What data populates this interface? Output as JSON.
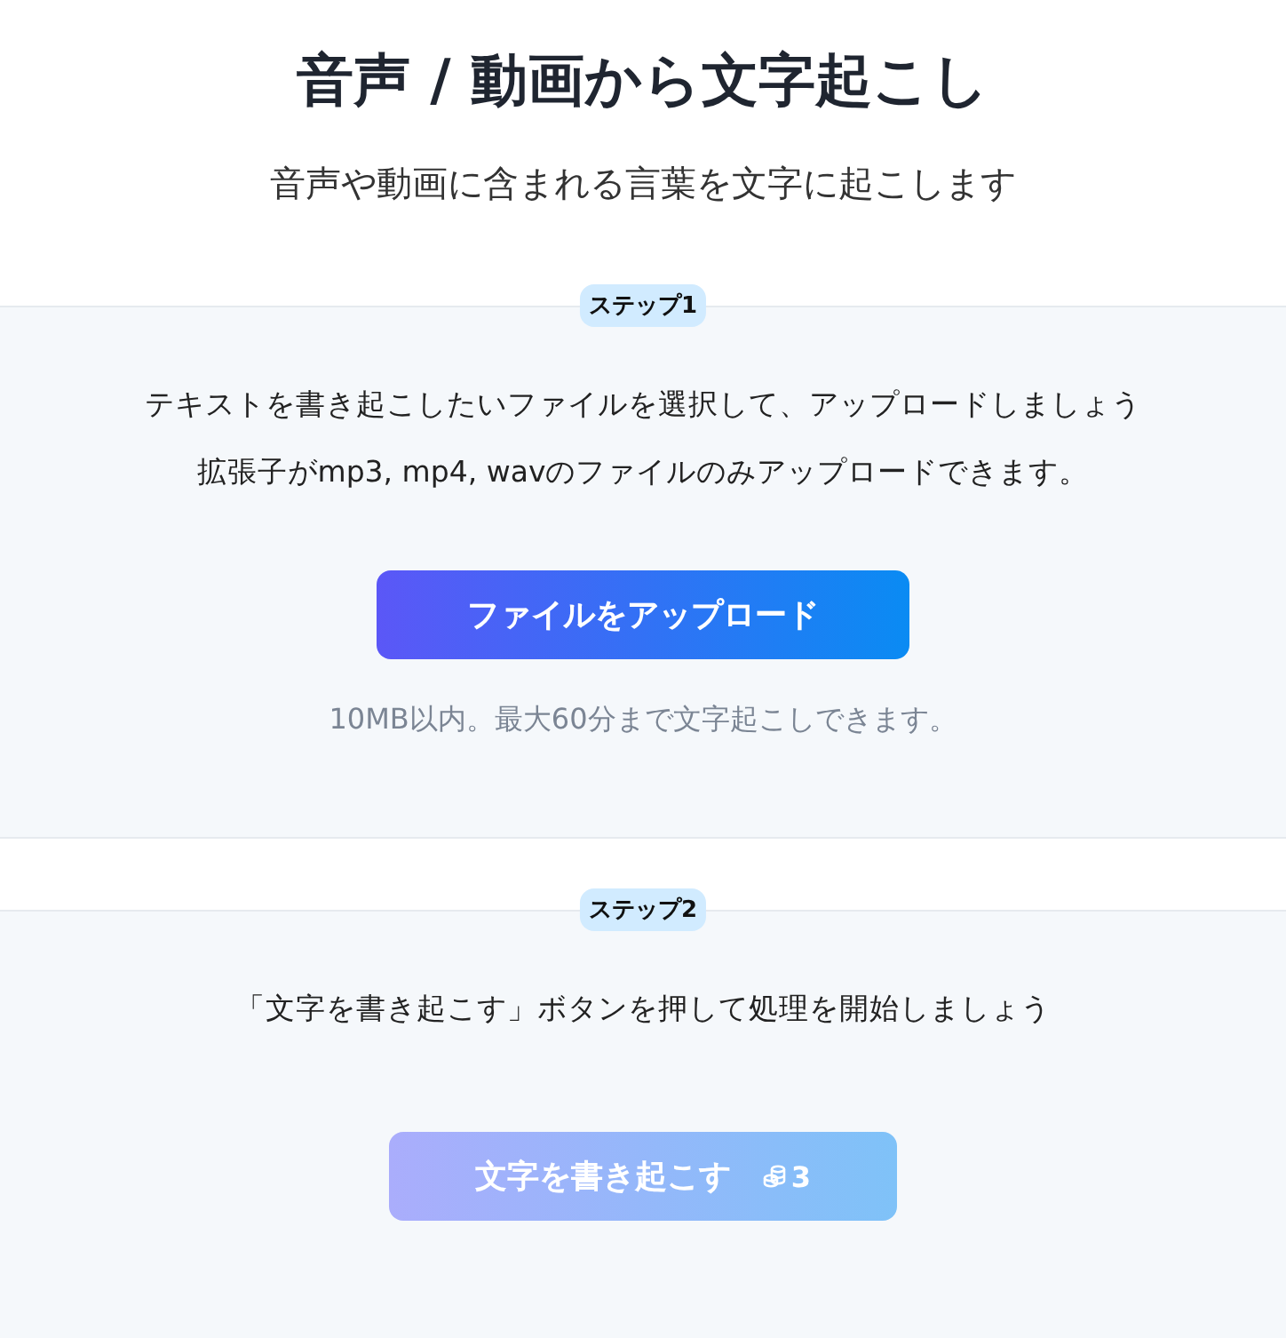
{
  "title": "音声 / 動画から文字起こし",
  "subtitle": "音声や動画に含まれる言葉を文字に起こします",
  "steps": [
    {
      "badge": "ステップ1",
      "lines": [
        "テキストを書き起こしたいファイルを選択して、アップロードしましょう",
        "拡張子がmp3, mp4, wavのファイルのみアップロードできます。"
      ],
      "button": {
        "label": "ファイルをアップロード",
        "disabled": false
      },
      "note": "10MB以内。最大60分まで文字起こしできます。"
    },
    {
      "badge": "ステップ2",
      "lines": [
        "「文字を書き起こす」ボタンを押して処理を開始しましょう"
      ],
      "button": {
        "label": "文字を書き起こす",
        "disabled": true,
        "cost": "3"
      }
    }
  ]
}
